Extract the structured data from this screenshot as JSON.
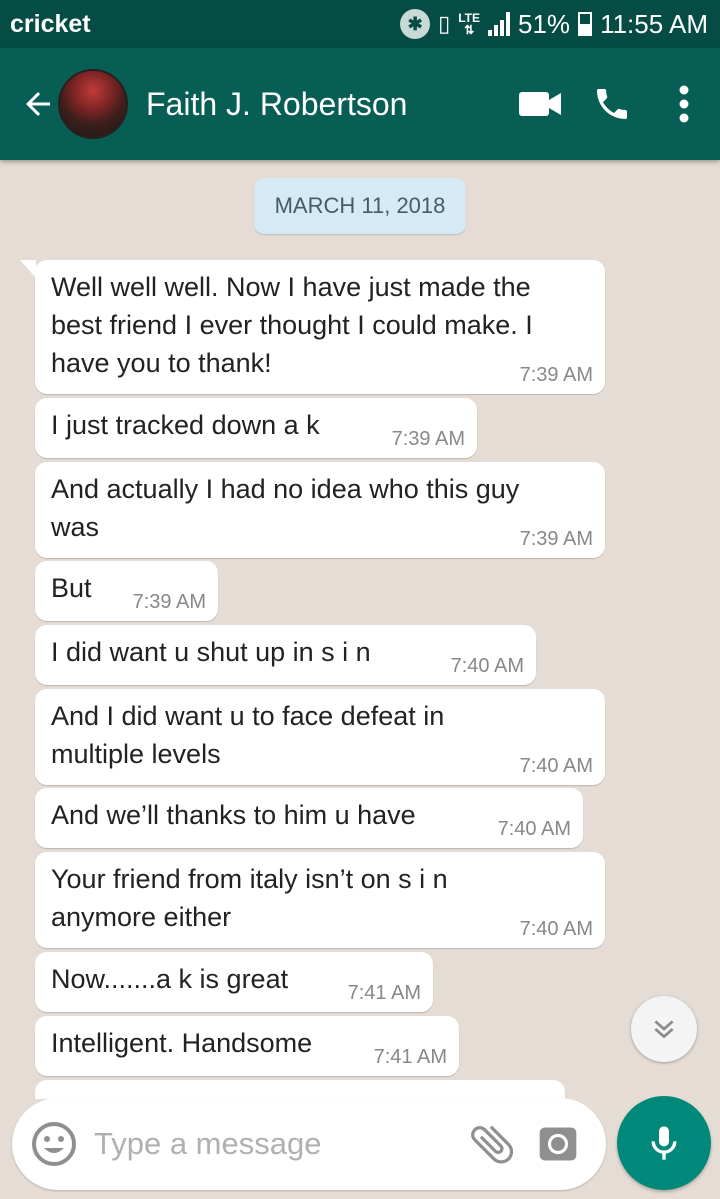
{
  "status_bar": {
    "carrier": "cricket",
    "network": "LTE",
    "battery": "51%",
    "time": "11:55 AM"
  },
  "header": {
    "contact_name": "Faith J. Robertson"
  },
  "chat": {
    "date": "MARCH 11, 2018",
    "messages": [
      {
        "lines": [
          "Well well well. Now I have just made the",
          "best friend I ever thought I could make. I",
          "have you to thank!"
        ],
        "time": "7:39 AM"
      },
      {
        "lines": [
          "I just tracked down a k"
        ],
        "time": "7:39 AM"
      },
      {
        "lines": [
          "And actually I had no idea who this guy",
          "was"
        ],
        "time": "7:39 AM"
      },
      {
        "lines": [
          "But"
        ],
        "time": "7:39 AM"
      },
      {
        "lines": [
          "I did want u shut up in s i n"
        ],
        "time": "7:40 AM"
      },
      {
        "lines": [
          "And I did want u to face defeat in",
          "multiple levels"
        ],
        "time": "7:40 AM"
      },
      {
        "lines": [
          "And we’ll thanks to him u have"
        ],
        "time": "7:40 AM"
      },
      {
        "lines": [
          "Your friend from italy isn’t on s i n",
          "anymore either"
        ],
        "time": "7:40 AM"
      },
      {
        "lines": [
          "Now.......a k is great"
        ],
        "time": "7:41 AM"
      },
      {
        "lines": [
          "Intelligent. Handsome"
        ],
        "time": "7:41 AM"
      }
    ]
  },
  "input": {
    "placeholder": "Type a message"
  },
  "colors": {
    "status_bar": "#054d44",
    "header": "#075e54",
    "chat_bg": "#e5ddd5",
    "date_chip": "#d4eaf4",
    "mic_button": "#00897b"
  },
  "icons": {
    "back": "arrow-left-icon",
    "video": "video-call-icon",
    "call": "phone-icon",
    "menu": "more-vert-icon",
    "scroll": "chevron-double-down-icon",
    "emoji": "emoji-icon",
    "attach": "paperclip-icon",
    "camera": "camera-icon",
    "mic": "microphone-icon"
  }
}
